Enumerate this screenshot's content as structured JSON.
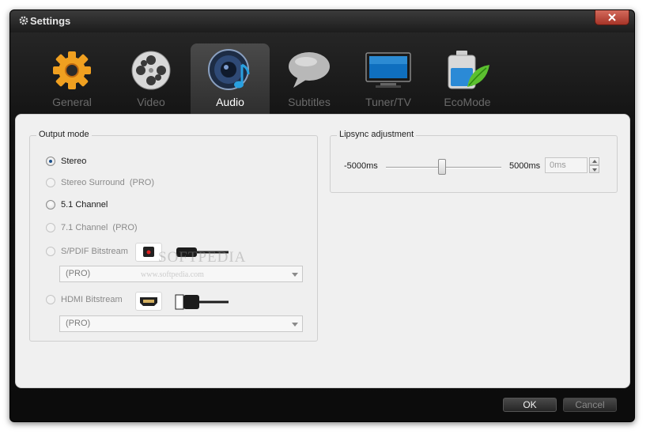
{
  "window": {
    "title": "Settings"
  },
  "tabs": [
    {
      "label": "General",
      "icon": "gear-icon",
      "active": false
    },
    {
      "label": "Video",
      "icon": "film-reel-icon",
      "active": false
    },
    {
      "label": "Audio",
      "icon": "speaker-music-icon",
      "active": true
    },
    {
      "label": "Subtitles",
      "icon": "speech-bubble-icon",
      "active": false
    },
    {
      "label": "Tuner/TV",
      "icon": "tv-icon",
      "active": false
    },
    {
      "label": "EcoMode",
      "icon": "battery-leaf-icon",
      "active": false
    }
  ],
  "output_mode": {
    "title": "Output mode",
    "options": [
      {
        "label": "Stereo",
        "checked": true,
        "enabled": true
      },
      {
        "label": "Stereo Surround  (PRO)",
        "checked": false,
        "enabled": false
      },
      {
        "label": "5.1 Channel",
        "checked": false,
        "enabled": true
      },
      {
        "label": "7.1 Channel  (PRO)",
        "checked": false,
        "enabled": false
      },
      {
        "label": "S/PDIF Bitstream",
        "checked": false,
        "enabled": false
      },
      {
        "label": "HDMI Bitstream",
        "checked": false,
        "enabled": false
      }
    ],
    "spdif_select": "(PRO)",
    "hdmi_select": "(PRO)"
  },
  "lipsync": {
    "title": "Lipsync adjustment",
    "min_label": "-5000ms",
    "max_label": "5000ms",
    "value": 0,
    "input_value": "0ms"
  },
  "buttons": {
    "ok": "OK",
    "cancel": "Cancel"
  },
  "watermark": {
    "brand": "SOFTPEDIA",
    "url": "www.softpedia.com"
  },
  "colors": {
    "accent": "#1b4f8a",
    "window_bg": "#111111",
    "panel_bg": "#f0f0f0"
  }
}
